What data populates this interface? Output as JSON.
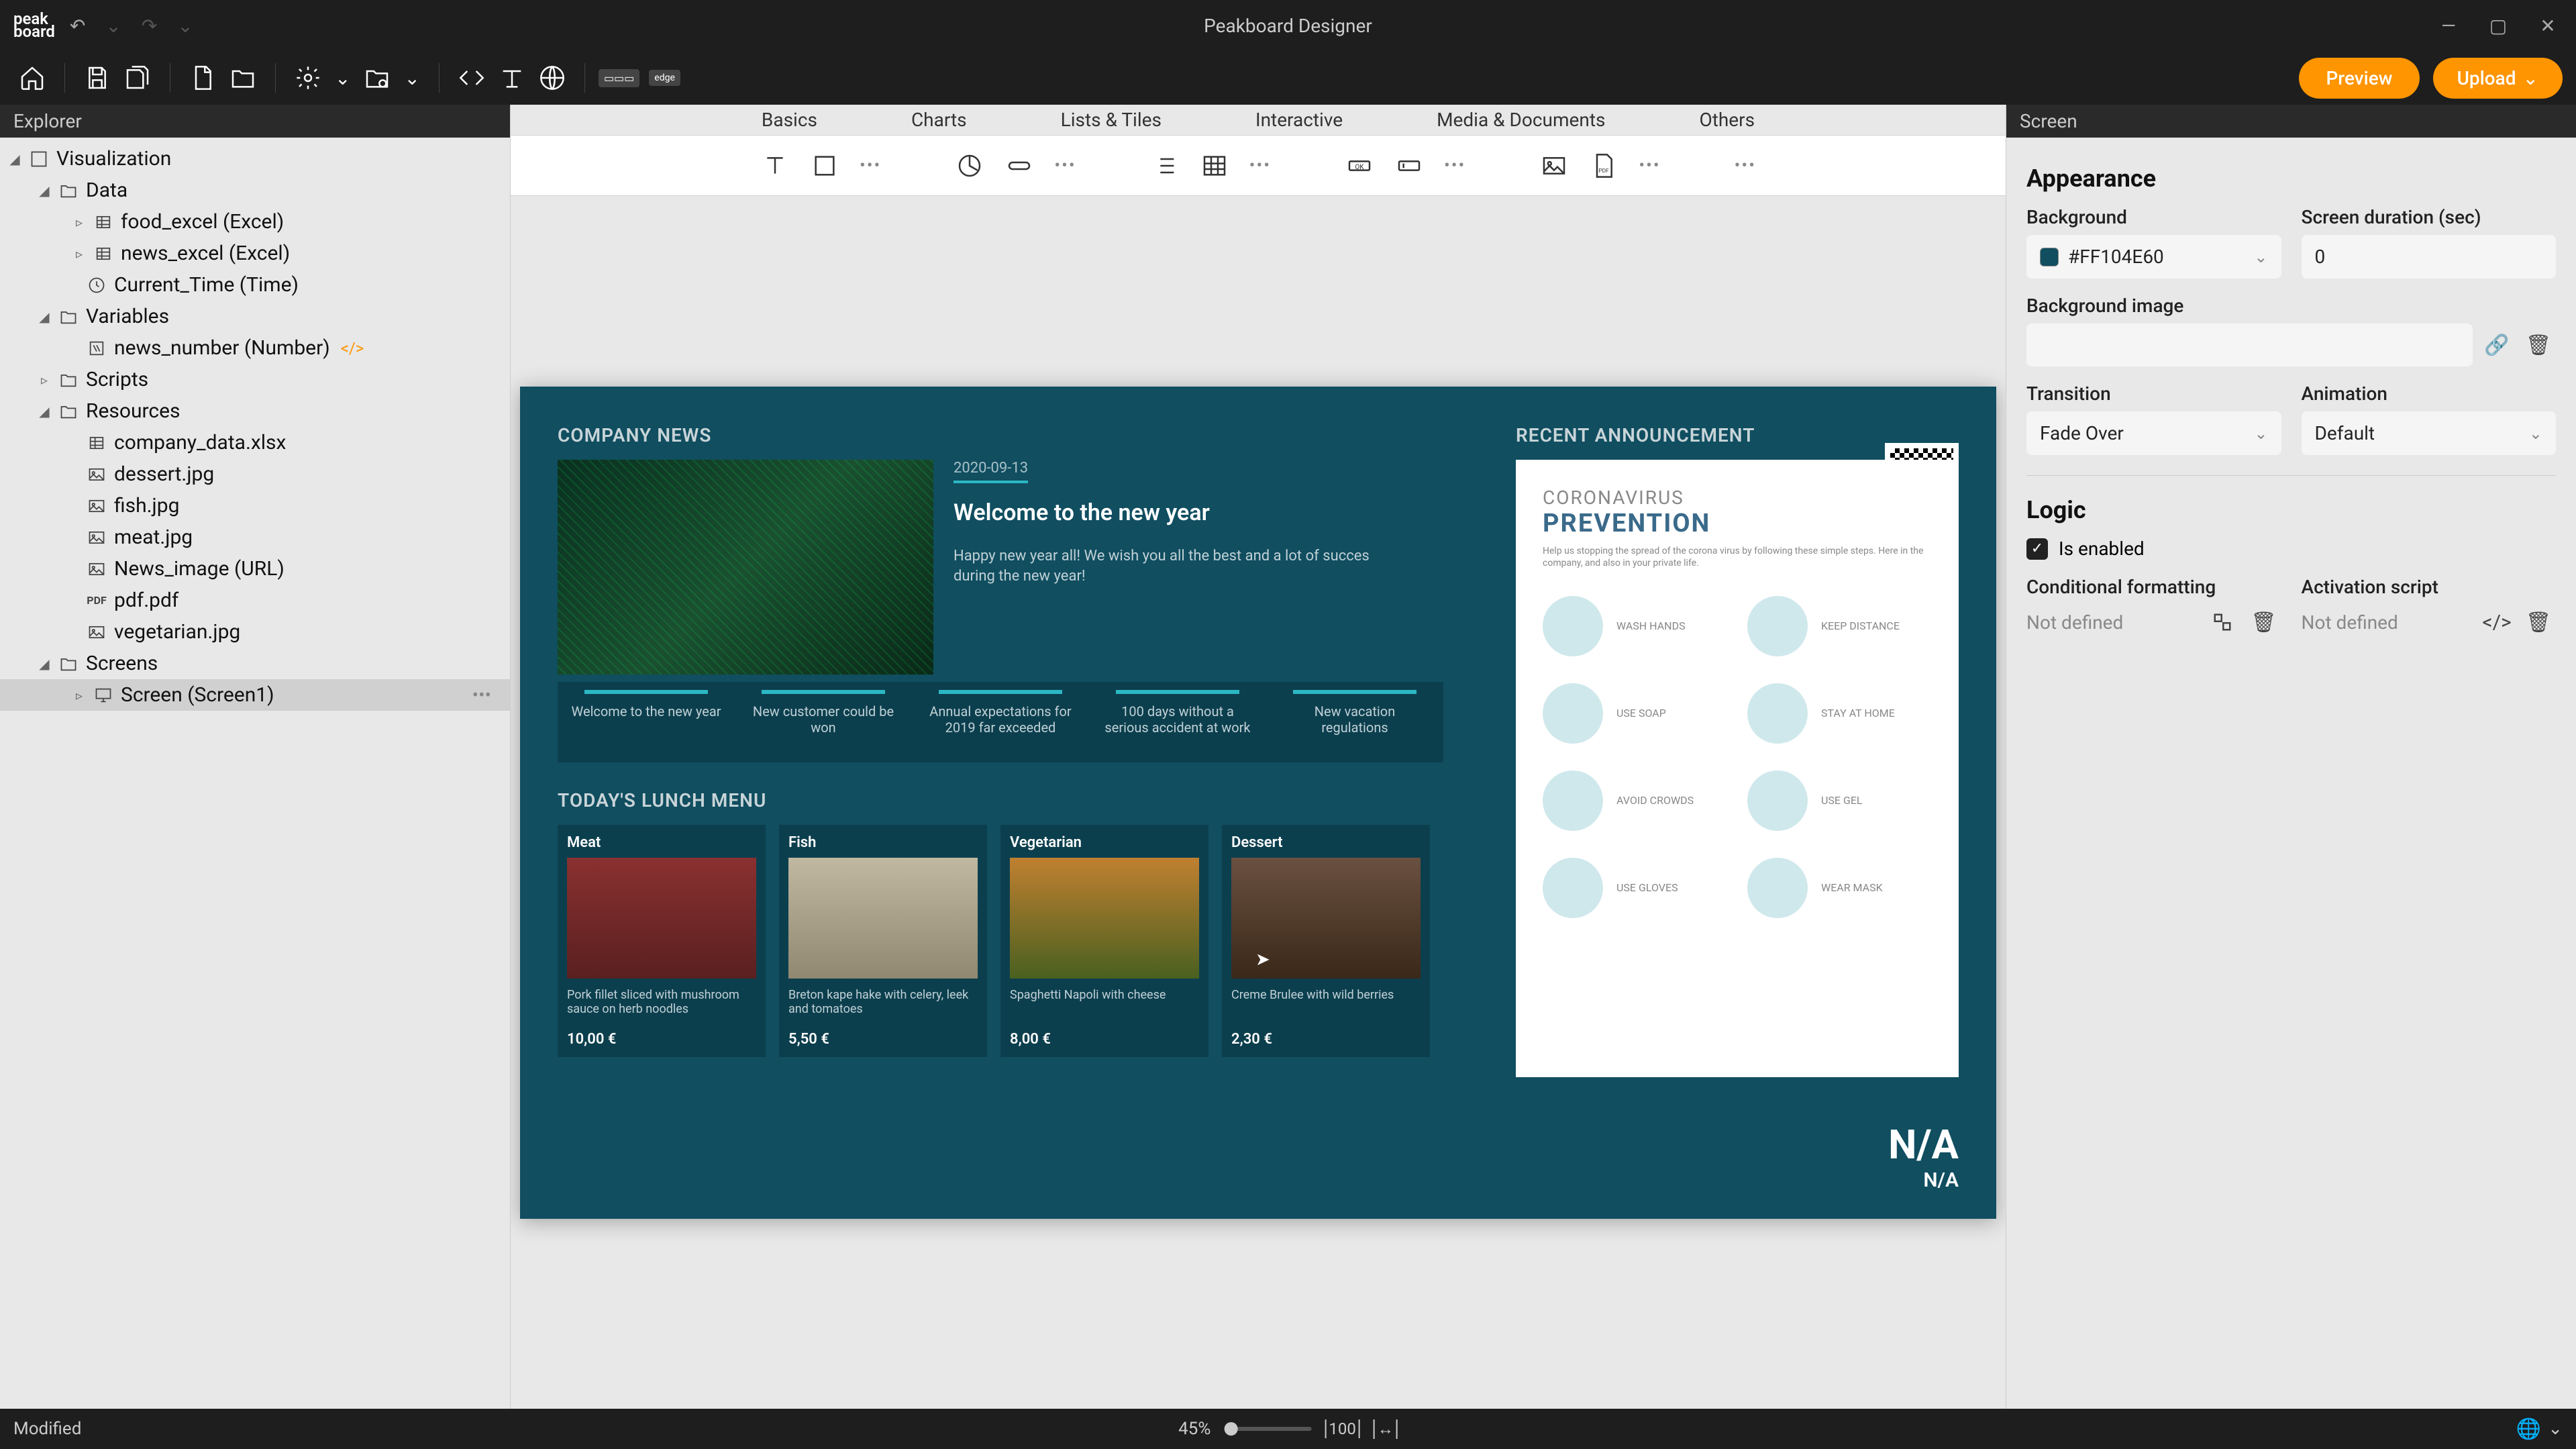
{
  "app": {
    "title": "Peakboard Designer",
    "logo": "peak\nboard"
  },
  "toolbar": {
    "preview": "Preview",
    "upload": "Upload"
  },
  "explorer": {
    "header": "Explorer",
    "root": "Visualization",
    "data": "Data",
    "data_items": [
      {
        "label": "food_excel (Excel)"
      },
      {
        "label": "news_excel (Excel)"
      },
      {
        "label": "Current_Time (Time)"
      }
    ],
    "variables": "Variables",
    "variable_items": [
      {
        "label": "news_number (Number)"
      }
    ],
    "scripts": "Scripts",
    "resources": "Resources",
    "resource_items": [
      {
        "label": "company_data.xlsx"
      },
      {
        "label": "dessert.jpg"
      },
      {
        "label": "fish.jpg"
      },
      {
        "label": "meat.jpg"
      },
      {
        "label": "News_image (URL)"
      },
      {
        "label": "pdf.pdf",
        "badge": "PDF"
      },
      {
        "label": "vegetarian.jpg"
      }
    ],
    "screens": "Screens",
    "screen_items": [
      {
        "label": "Screen (Screen1)"
      }
    ]
  },
  "ribbon": {
    "tabs": [
      "Basics",
      "Charts",
      "Lists & Tiles",
      "Interactive",
      "Media & Documents",
      "Others"
    ]
  },
  "screen": {
    "company_news": "COMPANY NEWS",
    "news_date": "2020-09-13",
    "news_headline": "Welcome to the new year",
    "news_body": "Happy new year all! We wish you all the best and a lot of succes during the new year!",
    "ticker": [
      "Welcome to the new year",
      "New customer could be won",
      "Annual expectations for 2019 far exceeded",
      "100 days without a serious accident at work",
      "New vacation regulations"
    ],
    "lunch_title": "TODAY'S LUNCH MENU",
    "lunch": [
      {
        "name": "Meat",
        "desc": "Pork fillet sliced with mushroom sauce on herb noodles",
        "price": "10,00 €"
      },
      {
        "name": "Fish",
        "desc": "Breton kape hake with celery, leek and tomatoes",
        "price": "5,50 €"
      },
      {
        "name": "Vegetarian",
        "desc": "Spaghetti Napoli with cheese",
        "price": "8,00 €"
      },
      {
        "name": "Dessert",
        "desc": "Creme Brulee with wild berries",
        "price": "2,30 €"
      }
    ],
    "announce_title": "RECENT ANNOUNCEMENT",
    "doc_t1": "CORONAVIRUS",
    "doc_t2": "PREVENTION",
    "doc_sub": "Help us stopping the spread of the corona virus by following these simple steps. Here in the company, and also in your private life.",
    "doc_items": [
      "WASH HANDS",
      "KEEP DISTANCE",
      "USE SOAP",
      "STAY AT HOME",
      "AVOID CROWDS",
      "USE GEL",
      "USE GLOVES",
      "WEAR MASK"
    ],
    "na1": "N/A",
    "na2": "N/A"
  },
  "props": {
    "header": "Screen",
    "appearance": "Appearance",
    "background": "Background",
    "background_value": "#FF104E60",
    "duration": "Screen duration (sec)",
    "duration_value": "0",
    "bg_image": "Background image",
    "transition": "Transition",
    "transition_value": "Fade Over",
    "animation": "Animation",
    "animation_value": "Default",
    "logic": "Logic",
    "enabled": "Is enabled",
    "cond_fmt": "Conditional formatting",
    "cond_fmt_value": "Not defined",
    "activation": "Activation script",
    "activation_value": "Not defined"
  },
  "status": {
    "modified": "Modified",
    "zoom": "45%"
  }
}
